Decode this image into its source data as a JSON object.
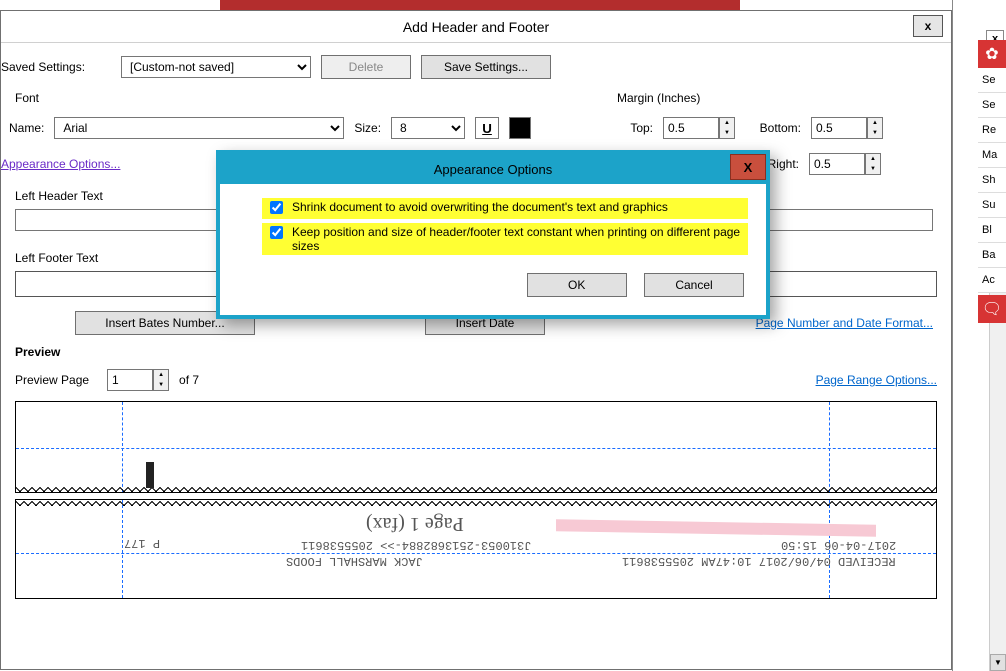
{
  "dialog": {
    "title": "Add Header and Footer",
    "close_x": "x"
  },
  "saved": {
    "label": "Saved Settings:",
    "value": "[Custom-not saved]",
    "delete_label": "Delete",
    "save_label": "Save Settings..."
  },
  "font": {
    "header": "Font",
    "name_label": "Name:",
    "name_value": "Arial",
    "size_label": "Size:",
    "size_value": "8",
    "underline_label": "U"
  },
  "margin": {
    "header": "Margin (Inches)",
    "top_label": "Top:",
    "top_value": "0.5",
    "bottom_label": "Bottom:",
    "bottom_value": "0.5",
    "right_label": "Right:",
    "right_value": "0.5"
  },
  "links": {
    "appearance": "Appearance Options...",
    "page_format": "Page Number and Date Format...",
    "page_range": "Page Range Options..."
  },
  "text_sections": {
    "left_header": "Left Header Text",
    "left_footer": "Left Footer Text"
  },
  "buttons": {
    "insert_bates": "Insert Bates Number...",
    "insert_date": "Insert Date"
  },
  "preview": {
    "header": "Preview",
    "page_label": "Preview Page",
    "page_value": "1",
    "page_total": "of 7",
    "sample_page_text": "Page 1  (fax)",
    "sample_p": "P 177",
    "sample_num": "J310053-2513682884->> 2055538611",
    "sample_jack": "JACK MARSHALL FOODS",
    "sample_right1": "2017-04-06 15:50",
    "sample_right2": "RECEIVED  04/06/2017 10:47AM 2055538611"
  },
  "modal": {
    "title": "Appearance Options",
    "close_x": "X",
    "opt1": "Shrink document to avoid overwriting  the document's text and graphics",
    "opt2": "Keep position and size of header/footer text constant when printing on different page sizes",
    "ok": "OK",
    "cancel": "Cancel"
  },
  "right_panel": {
    "close_x": "x",
    "items": [
      "Se",
      "Se",
      "Re",
      "Ma",
      "Sh",
      "Su",
      "Bl",
      "Ba",
      "Ac"
    ]
  }
}
